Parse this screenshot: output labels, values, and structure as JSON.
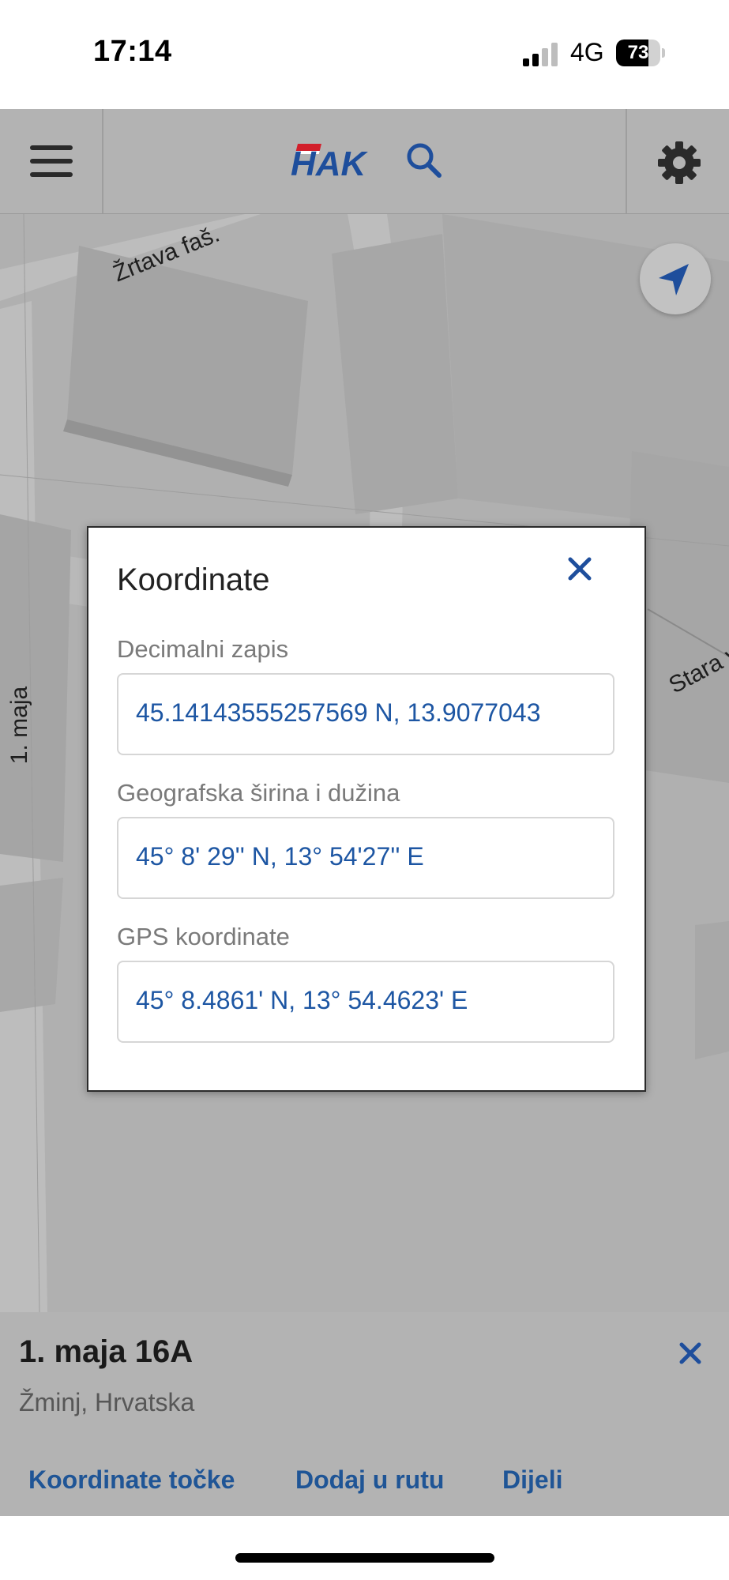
{
  "status_bar": {
    "time": "17:14",
    "network": "4G",
    "battery": 73,
    "signal_bars_active": 2,
    "signal_bars_total": 4
  },
  "header": {
    "logo_text": "HAK",
    "menu_icon": "menu-icon",
    "search_icon": "search-icon",
    "settings_icon": "gear-icon"
  },
  "map": {
    "streets": [
      "Žrtava faš.",
      "1. maja",
      "Stara v"
    ],
    "locate_icon": "navigation-arrow-icon"
  },
  "modal": {
    "title": "Koordinate",
    "close_icon": "close-icon",
    "fields": [
      {
        "label": "Decimalni zapis",
        "value": "45.14143555257569 N, 13.9077043"
      },
      {
        "label": "Geografska širina i dužina",
        "value": "45° 8' 29'' N, 13° 54'27'' E"
      },
      {
        "label": "GPS koordinate",
        "value": "45° 8.4861' N, 13° 54.4623' E"
      }
    ]
  },
  "bottom_sheet": {
    "title": "1. maja 16A",
    "subtitle": "Žminj, Hrvatska",
    "close_icon": "close-icon",
    "actions": [
      "Koordinate točke",
      "Dodaj u rutu",
      "Dijeli"
    ]
  },
  "colors": {
    "accent": "#1f5596",
    "link_blue": "#1d56a3",
    "logo_blue": "#1e4e9c",
    "logo_red": "#d21f2b",
    "dim_overlay": "#b3b3b3"
  }
}
